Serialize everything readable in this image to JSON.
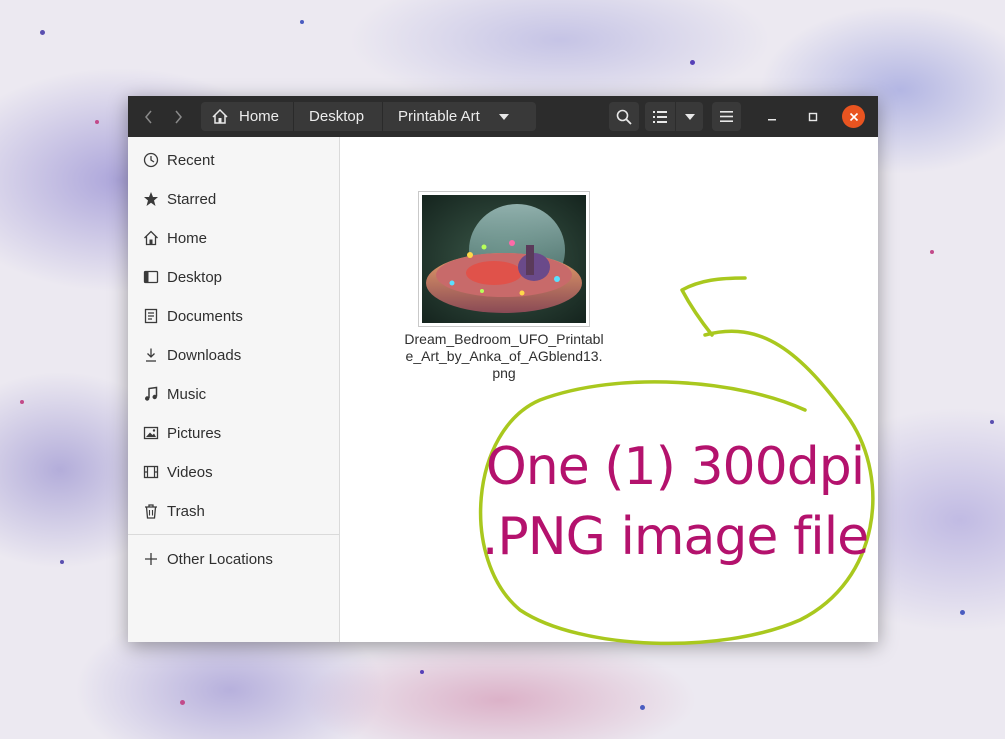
{
  "window": {
    "breadcrumb": [
      "Home",
      "Desktop",
      "Printable Art"
    ],
    "buttons": {
      "back": "back-arrow",
      "forward": "forward-arrow",
      "search": "search-icon",
      "view": "list-view-icon",
      "view_options": "chevron-down-icon",
      "menu": "hamburger-menu-icon",
      "minimize": "minimize-icon",
      "maximize": "maximize-icon",
      "close": "close-icon"
    },
    "colors": {
      "header": "#2c2c2c",
      "close": "#e95420",
      "sidebar": "#f6f6f6"
    }
  },
  "sidebar": {
    "items": [
      {
        "label": "Recent",
        "icon": "clock-icon"
      },
      {
        "label": "Starred",
        "icon": "star-icon"
      },
      {
        "label": "Home",
        "icon": "home-icon"
      },
      {
        "label": "Desktop",
        "icon": "desktop-icon"
      },
      {
        "label": "Documents",
        "icon": "document-icon"
      },
      {
        "label": "Downloads",
        "icon": "download-icon"
      },
      {
        "label": "Music",
        "icon": "music-icon"
      },
      {
        "label": "Pictures",
        "icon": "picture-icon"
      },
      {
        "label": "Videos",
        "icon": "video-icon"
      },
      {
        "label": "Trash",
        "icon": "trash-icon"
      }
    ],
    "other_locations": {
      "label": "Other Locations",
      "icon": "plus-icon"
    }
  },
  "files": [
    {
      "name": "Dream_Bedroom_UFO_Printable_Art_by_Anka_of_AGblend13.png"
    }
  ],
  "annotation": {
    "line1": "One (1) 300dpi",
    "line2": ".PNG image file",
    "text_color": "#b4126d",
    "circle_color": "#a9c81e"
  }
}
